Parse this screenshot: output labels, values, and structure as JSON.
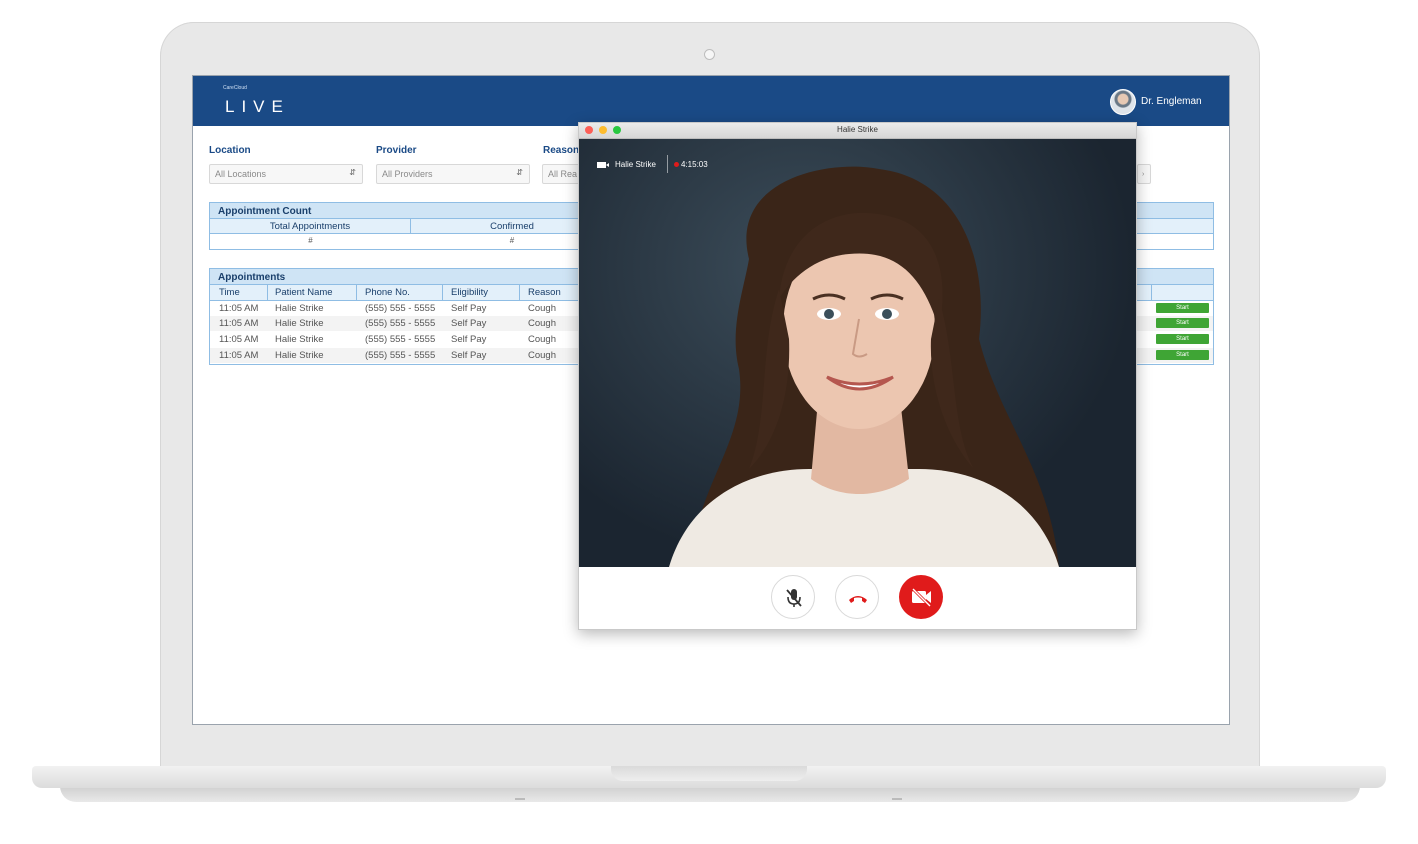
{
  "app": {
    "brand_small": "CareCloud",
    "brand_main": "LIVE",
    "user_name": "Dr. Engleman"
  },
  "filters": {
    "location": {
      "label": "Location",
      "value": "All Locations"
    },
    "provider": {
      "label": "Provider",
      "value": "All Providers"
    },
    "reason": {
      "label": "Reason",
      "value": "All Rea"
    }
  },
  "appointment_count": {
    "title": "Appointment Count",
    "columns": [
      "Total Appointments",
      "Confirmed"
    ],
    "values": [
      "#",
      "#"
    ]
  },
  "appointments": {
    "title": "Appointments",
    "columns": [
      "Time",
      "Patient Name",
      "Phone No.",
      "Eligibility",
      "Reason"
    ],
    "rows": [
      {
        "time": "11:05 AM",
        "patient": "Halie Strike",
        "phone": "(555) 555 - 5555",
        "eligibility": "Self Pay",
        "reason": "Cough",
        "action": "Start"
      },
      {
        "time": "11:05 AM",
        "patient": "Halie Strike",
        "phone": "(555) 555 - 5555",
        "eligibility": "Self Pay",
        "reason": "Cough",
        "action": "Start"
      },
      {
        "time": "11:05 AM",
        "patient": "Halie Strike",
        "phone": "(555) 555 - 5555",
        "eligibility": "Self Pay",
        "reason": "Cough",
        "action": "Start"
      },
      {
        "time": "11:05 AM",
        "patient": "Halie Strike",
        "phone": "(555) 555 - 5555",
        "eligibility": "Self Pay",
        "reason": "Cough",
        "action": "Start"
      }
    ]
  },
  "video_call": {
    "window_title": "Halie Strike",
    "caller_name": "Halie Strike",
    "duration": "4:15:03",
    "controls": {
      "mute_icon": "mic-off-icon",
      "hangup_icon": "hang-up-icon",
      "video_icon": "video-off-icon"
    }
  },
  "colors": {
    "header_blue": "#1a4a86",
    "panel_blue": "#cfe4f5",
    "start_green": "#3fa535",
    "end_red": "#e01b1b"
  }
}
